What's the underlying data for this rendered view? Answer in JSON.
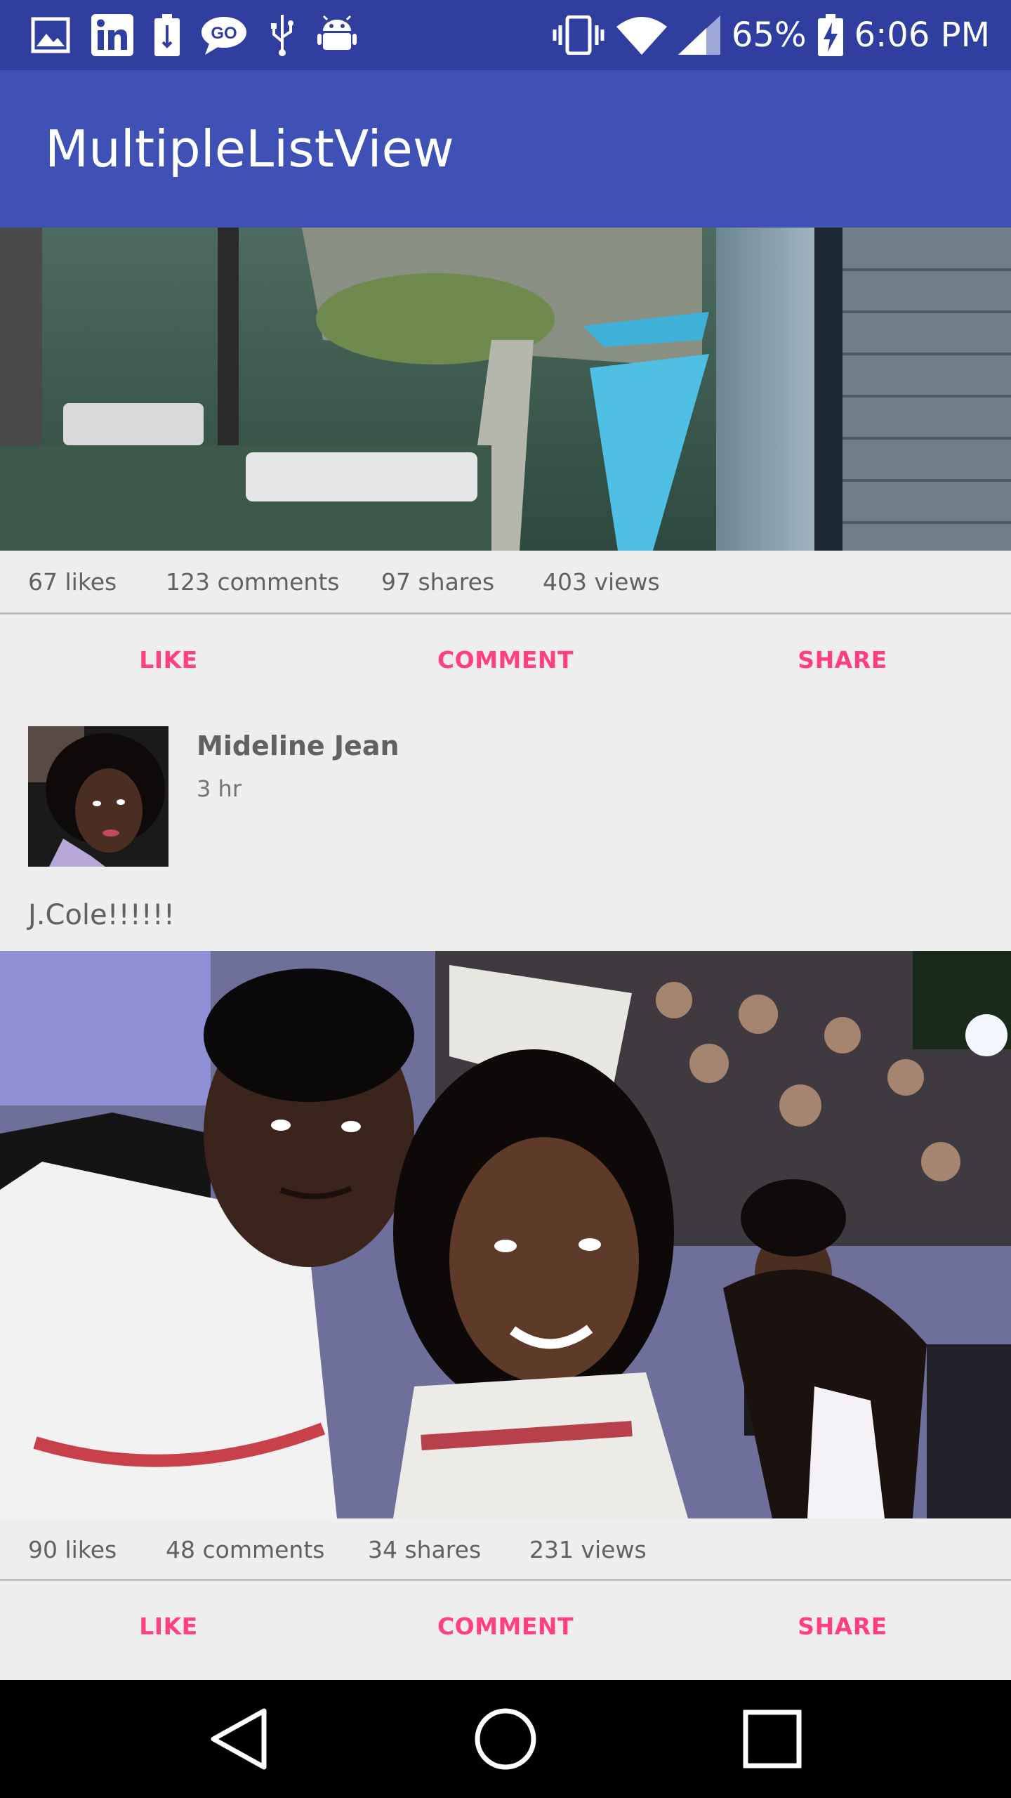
{
  "status_bar": {
    "battery_percent": "65%",
    "time": "6:06 PM",
    "left_icons": [
      "image-icon",
      "linkedin-icon",
      "battery-saver-icon",
      "go-chat-icon",
      "usb-icon",
      "android-icon"
    ],
    "right_icons": [
      "vibrate-icon",
      "wifi-icon",
      "signal-icon",
      "battery-charging-icon"
    ]
  },
  "app_bar": {
    "title": "MultipleListView"
  },
  "posts": [
    {
      "photo": "city-pool-photo",
      "stats": {
        "likes": "67 likes",
        "comments": "123 comments",
        "shares": "97 shares",
        "views": "403 views"
      },
      "actions": {
        "like": "LIKE",
        "comment": "COMMENT",
        "share": "SHARE"
      }
    },
    {
      "author": {
        "name": "Mideline Jean",
        "time": "3 hr"
      },
      "text": "J.Cole!!!!!!",
      "photo": "concert-selfie-photo",
      "stats": {
        "likes": "90 likes",
        "comments": "48 comments",
        "shares": "34 shares",
        "views": "231 views"
      },
      "actions": {
        "like": "LIKE",
        "comment": "COMMENT",
        "share": "SHARE"
      }
    }
  ],
  "colors": {
    "status_bar": "#303f9f",
    "app_bar": "#3f51b5",
    "accent": "#ff4081",
    "background": "#eeeeee"
  }
}
